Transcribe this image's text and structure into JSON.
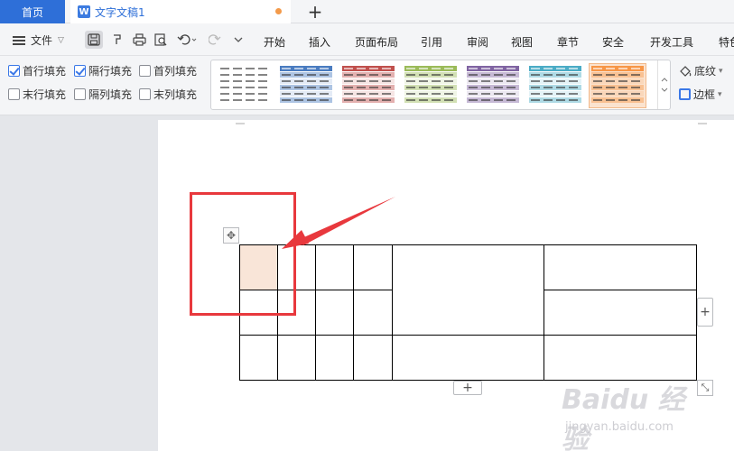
{
  "tabs": {
    "home": "首页",
    "document": "文字文稿1",
    "doc_icon": "W",
    "new_tab": "+"
  },
  "menubar": {
    "file": "文件",
    "items": [
      "开始",
      "插入",
      "页面布局",
      "引用",
      "审阅",
      "视图",
      "章节",
      "安全",
      "开发工具",
      "特色"
    ]
  },
  "ribbon": {
    "checkboxes": [
      {
        "label": "首行填充",
        "checked": true
      },
      {
        "label": "隔行填充",
        "checked": true
      },
      {
        "label": "首列填充",
        "checked": false
      },
      {
        "label": "末行填充",
        "checked": false
      },
      {
        "label": "隔列填充",
        "checked": false
      },
      {
        "label": "末列填充",
        "checked": false
      }
    ],
    "shading": "底纹",
    "border": "边框",
    "table_styles": [
      {
        "name": "plain",
        "color": "#555555"
      },
      {
        "name": "blue",
        "color": "#4a7cc0"
      },
      {
        "name": "red",
        "color": "#c0504d"
      },
      {
        "name": "green",
        "color": "#9bbb59"
      },
      {
        "name": "purple",
        "color": "#8064a2"
      },
      {
        "name": "teal",
        "color": "#4bacc6"
      },
      {
        "name": "orange",
        "color": "#f79646"
      }
    ],
    "selected_style": "orange"
  },
  "document": {
    "selected_cell_color": "#f9e5d8",
    "annotation_color": "#e8383d"
  },
  "table_controls": {
    "move": "✥",
    "add_column": "+",
    "add_row": "+",
    "resize": "⤡"
  },
  "watermark": {
    "brand": "Baidu 经验",
    "url": "jingyan.baidu.com"
  }
}
